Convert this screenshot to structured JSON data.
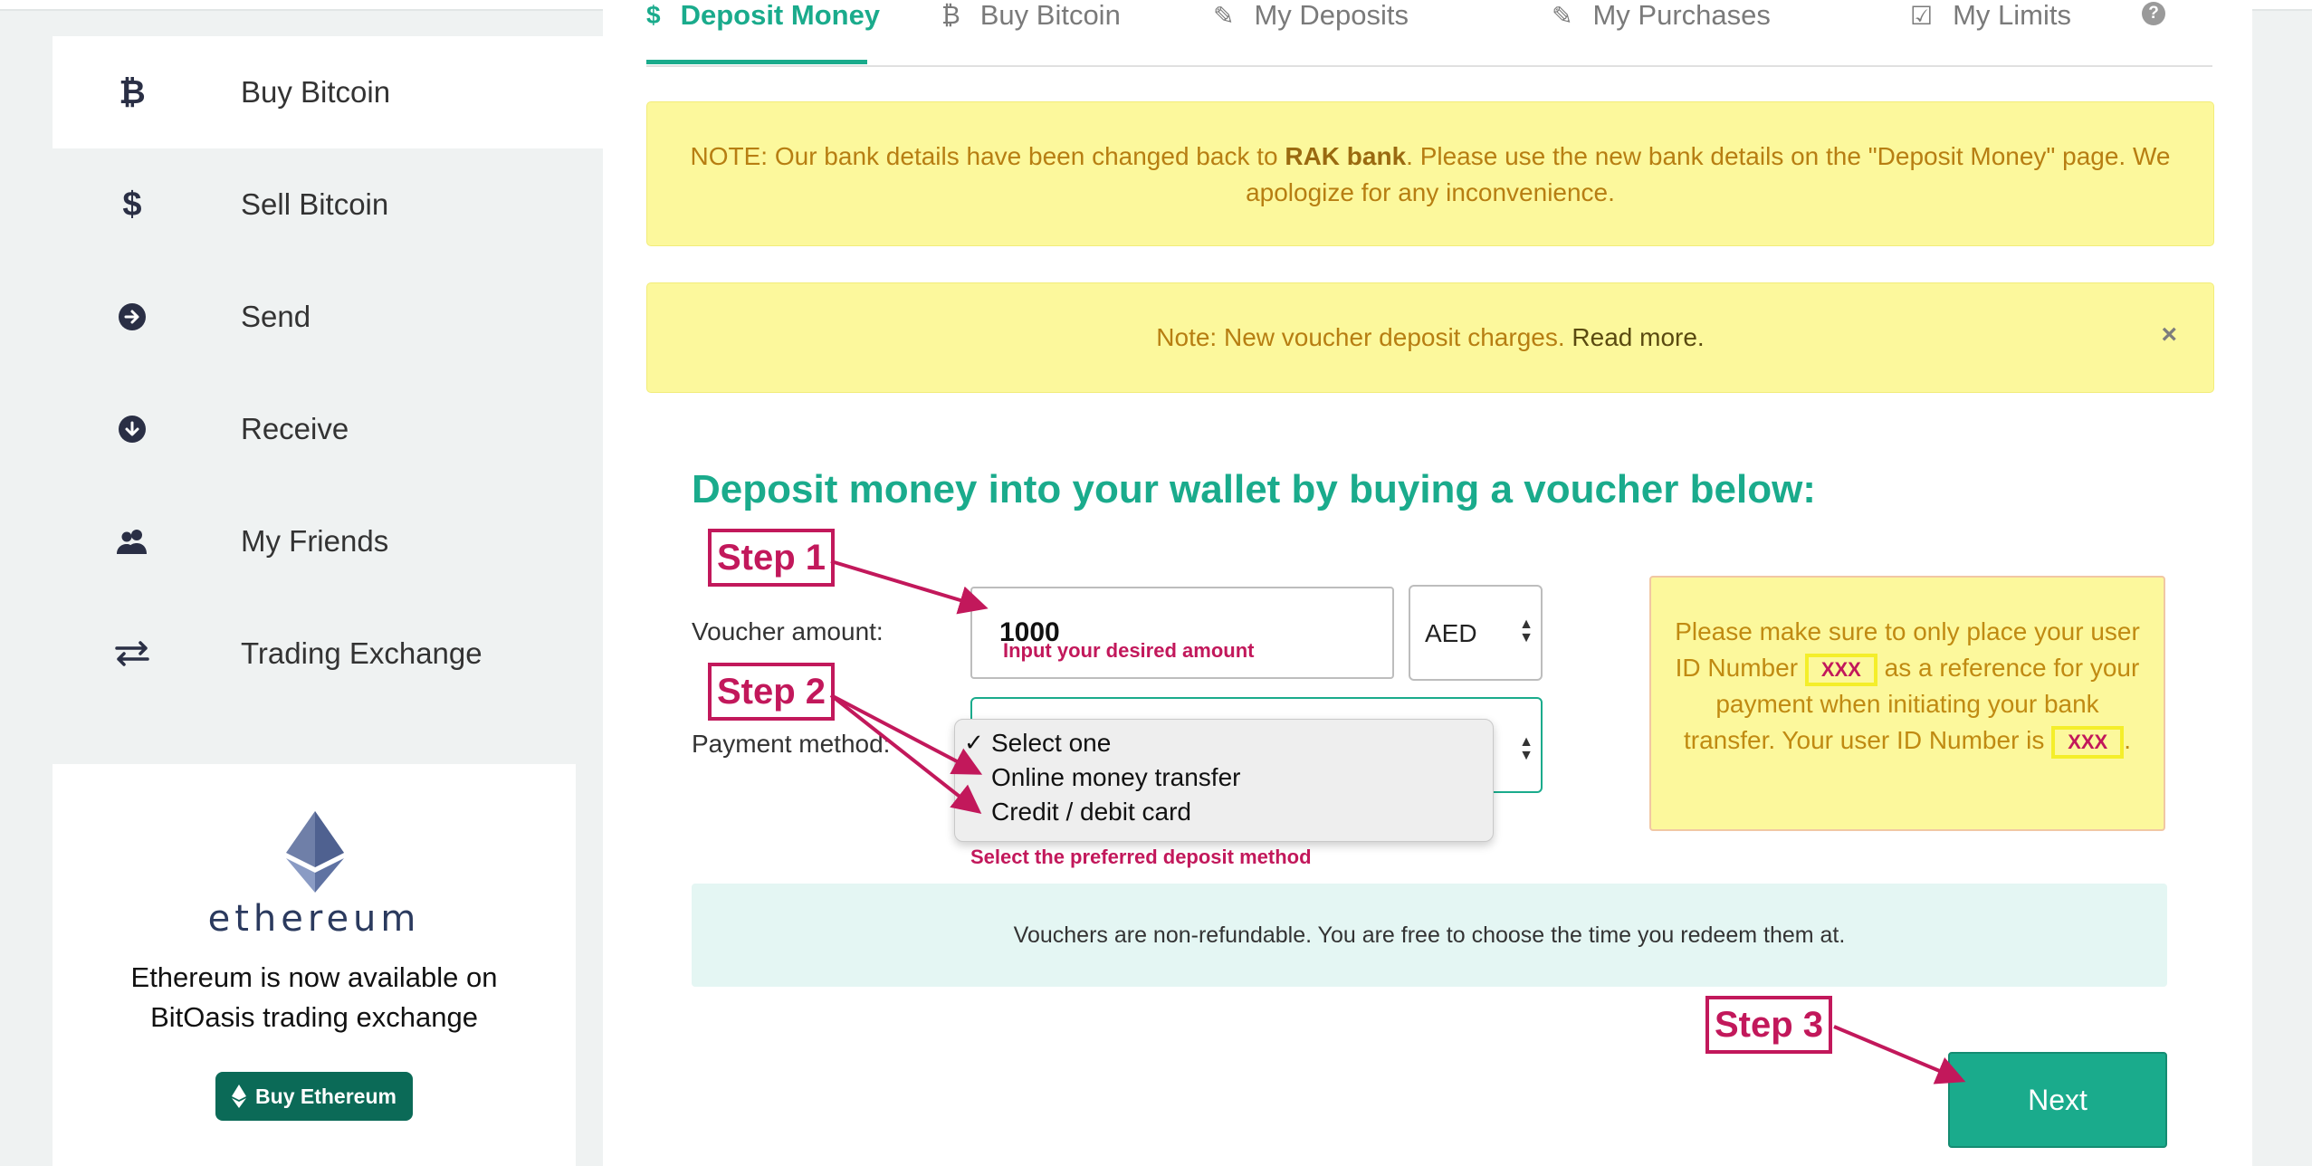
{
  "sidebar": {
    "items": [
      {
        "label": "Buy Bitcoin",
        "icon": "bitcoin-icon"
      },
      {
        "label": "Sell Bitcoin",
        "icon": "dollar-icon"
      },
      {
        "label": "Send",
        "icon": "arrow-right-circle-icon"
      },
      {
        "label": "Receive",
        "icon": "arrow-down-circle-icon"
      },
      {
        "label": "My Friends",
        "icon": "users-icon"
      },
      {
        "label": "Trading Exchange",
        "icon": "exchange-icon"
      }
    ]
  },
  "promo": {
    "logo_word": "ethereum",
    "text_line1": "Ethereum is now available on",
    "text_line2": "BitOasis trading exchange",
    "button": "Buy Ethereum"
  },
  "tabs": [
    {
      "label": "Deposit Money",
      "icon": "$"
    },
    {
      "label": "Buy Bitcoin",
      "icon": "₿"
    },
    {
      "label": "My Deposits",
      "icon": "✎"
    },
    {
      "label": "My Purchases",
      "icon": "✎"
    },
    {
      "label": "My Limits",
      "icon": "☑"
    }
  ],
  "help_icon": "?",
  "notices": {
    "bank_prefix": "NOTE: Our bank details have been changed back to ",
    "bank_name": "RAK bank",
    "bank_suffix": ". Please use the new bank details on the \"Deposit Money\" page. We apologize for any inconvenience.",
    "voucher_text": "Note: New voucher deposit charges. ",
    "read_more": "Read more.",
    "close": "×"
  },
  "form": {
    "heading": "Deposit money into your wallet by buying a voucher below:",
    "amount_label": "Voucher amount:",
    "amount_value": "1000",
    "amount_hint": "Input your desired amount",
    "currency": "AED",
    "method_label": "Payment method:",
    "method_options": [
      "Select one",
      "Online money transfer",
      "Credit / debit card"
    ],
    "method_hint": "Select the preferred deposit method",
    "refund_note": "Vouchers are non-refundable. You are free to choose the time you redeem them at.",
    "next_button": "Next"
  },
  "id_note": {
    "part1": "Please make sure to only place your user ID Number",
    "xxx1": "XXX",
    "part2": "as a reference for your payment when initiating your bank transfer. Your user ID Number is",
    "xxx2": "XXX",
    "part3": "."
  },
  "steps": {
    "step1": "Step 1",
    "step2": "Step 2",
    "step3": "Step 3"
  },
  "colors": {
    "accent": "#1aab8c",
    "notice_bg": "#fcf89c",
    "annotation": "#c2185b",
    "promo_button": "#0b6a57"
  }
}
